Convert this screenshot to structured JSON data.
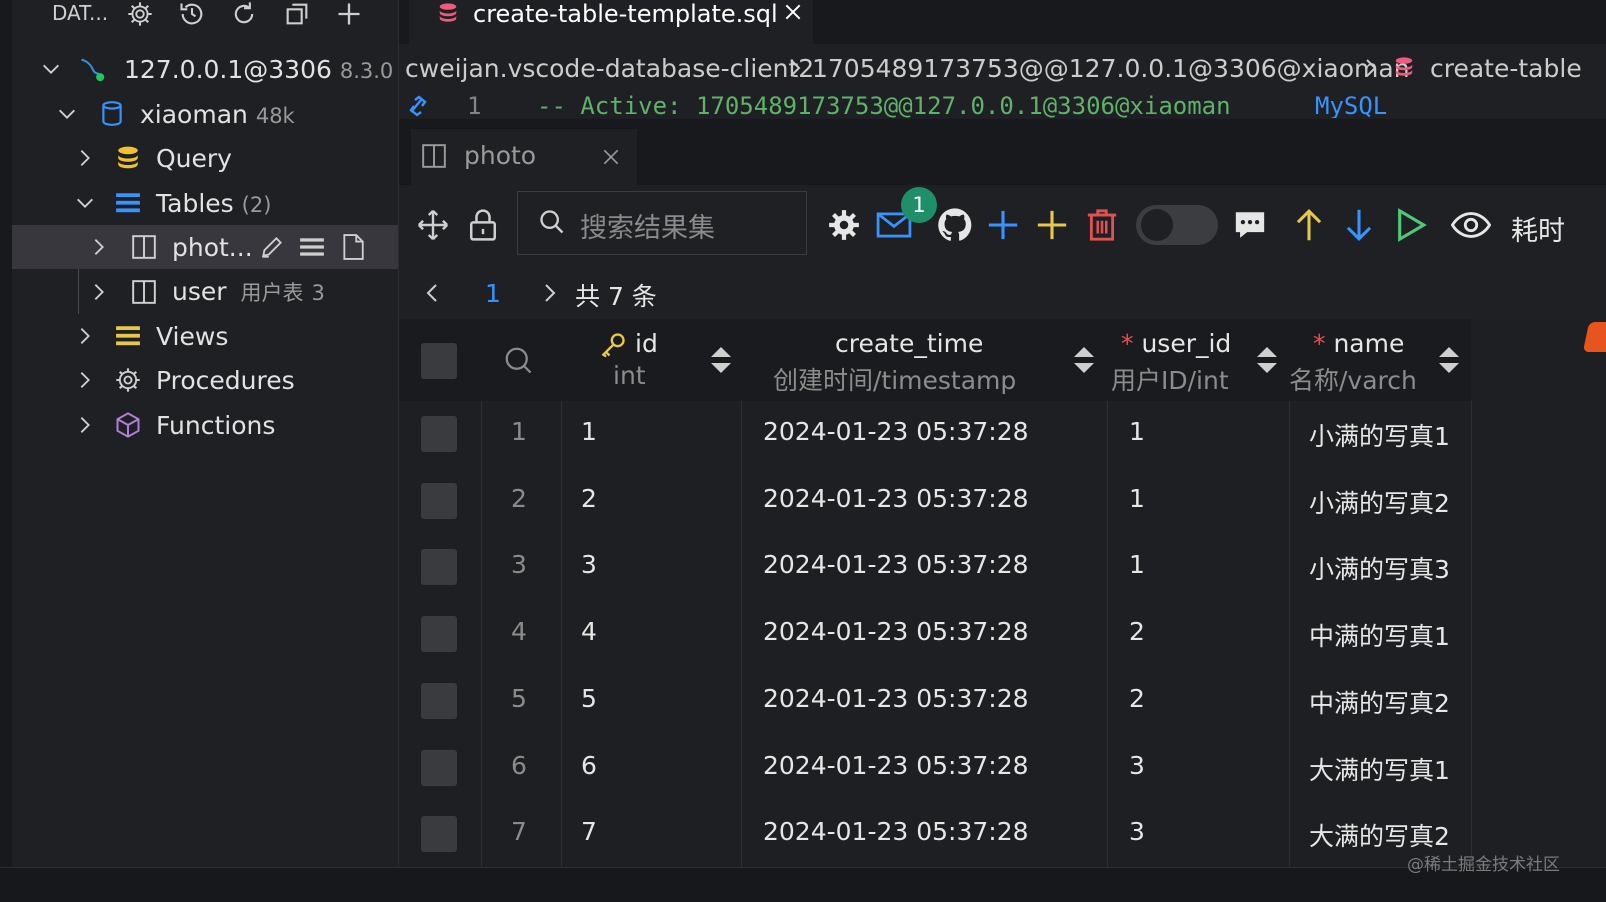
{
  "sidebar": {
    "title": "DAT...",
    "connection": {
      "label": "127.0.0.1@3306",
      "version": "8.3.0"
    },
    "database": {
      "label": "xiaoman",
      "size": "48k"
    },
    "query": "Query",
    "tables": {
      "label": "Tables",
      "count": "(2)"
    },
    "table_items": [
      {
        "label": "phot..."
      },
      {
        "label": "user",
        "comment": "用户表",
        "count": "3"
      }
    ],
    "views": "Views",
    "procedures": "Procedures",
    "functions": "Functions"
  },
  "editor": {
    "tab_label": "create-table-template.sql",
    "breadcrumb": [
      "cweijan.vscode-database-client2",
      "1705489173753@@127.0.0.1@3306@xiaoman",
      "create-table"
    ],
    "code_line_number": "1",
    "code_comment": "-- Active: 1705489173753@@127.0.0.1@3306@xiaoman",
    "code_dialect": "MySQL"
  },
  "result": {
    "tab_label": "photo",
    "search_placeholder": "搜索结果集",
    "notification_count": "1",
    "timing_label": "耗时",
    "pager": {
      "page": "1",
      "total": "共 7 条"
    },
    "columns": [
      {
        "name": "id",
        "type": "int"
      },
      {
        "name": "create_time",
        "type": "创建时间/timestamp"
      },
      {
        "name": "user_id",
        "type": "用户ID/int",
        "required": "*"
      },
      {
        "name": "name",
        "type": "名称/varch",
        "required": "*"
      }
    ],
    "rows": [
      {
        "n": "1",
        "id": "1",
        "create_time": "2024-01-23 05:37:28",
        "user_id": "1",
        "name": "小满的写真1"
      },
      {
        "n": "2",
        "id": "2",
        "create_time": "2024-01-23 05:37:28",
        "user_id": "1",
        "name": "小满的写真2"
      },
      {
        "n": "3",
        "id": "3",
        "create_time": "2024-01-23 05:37:28",
        "user_id": "1",
        "name": "小满的写真3"
      },
      {
        "n": "4",
        "id": "4",
        "create_time": "2024-01-23 05:37:28",
        "user_id": "2",
        "name": "中满的写真1"
      },
      {
        "n": "5",
        "id": "5",
        "create_time": "2024-01-23 05:37:28",
        "user_id": "2",
        "name": "中满的写真2"
      },
      {
        "n": "6",
        "id": "6",
        "create_time": "2024-01-23 05:37:28",
        "user_id": "3",
        "name": "大满的写真1"
      },
      {
        "n": "7",
        "id": "7",
        "create_time": "2024-01-23 05:37:28",
        "user_id": "3",
        "name": "大满的写真2"
      }
    ]
  },
  "watermark": "@稀土掘金技术社区",
  "colors": {
    "accent_blue": "#3794ff",
    "add_blue": "#3794ff",
    "add_yellow": "#e8c84c",
    "delete_red": "#e05252",
    "arrow_yellow": "#e8c84c",
    "play_green": "#4ec97a",
    "code_green": "#5fb26a",
    "sql_pink": "#f05a7e"
  }
}
